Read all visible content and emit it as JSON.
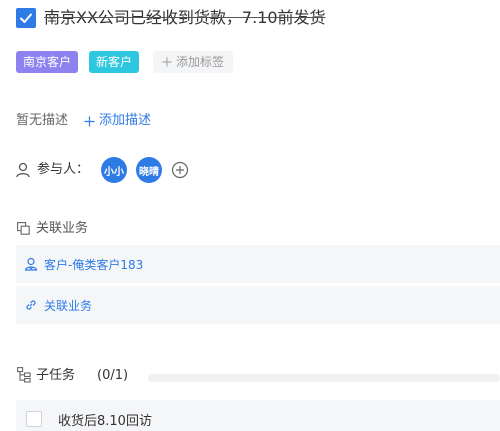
{
  "task": {
    "title": "南京XX公司已经收到货款，7.10前发货",
    "completed": true
  },
  "tags": {
    "items": [
      {
        "label": "南京客户",
        "color": "#8c83f0"
      },
      {
        "label": "新客户",
        "color": "#2ec7e0"
      }
    ],
    "add_label": "添加标签"
  },
  "description": {
    "empty_text": "暂无描述",
    "add_label": "添加描述"
  },
  "participants": {
    "label": "参与人：",
    "people": [
      {
        "name": "小小"
      },
      {
        "name": "晓晴"
      }
    ]
  },
  "related": {
    "heading": "关联业务",
    "items": [
      {
        "label": "客户-俺类客户183",
        "icon": "customer-icon"
      },
      {
        "label": "关联业务",
        "icon": "link-icon"
      }
    ]
  },
  "subtasks": {
    "heading": "子任务",
    "count": "(0/1)",
    "progress": 0,
    "items": [
      {
        "label": "收货后8.10回访",
        "done": false
      }
    ]
  },
  "colors": {
    "accent": "#2f7be6",
    "row_bg": "#f5f6f8"
  }
}
